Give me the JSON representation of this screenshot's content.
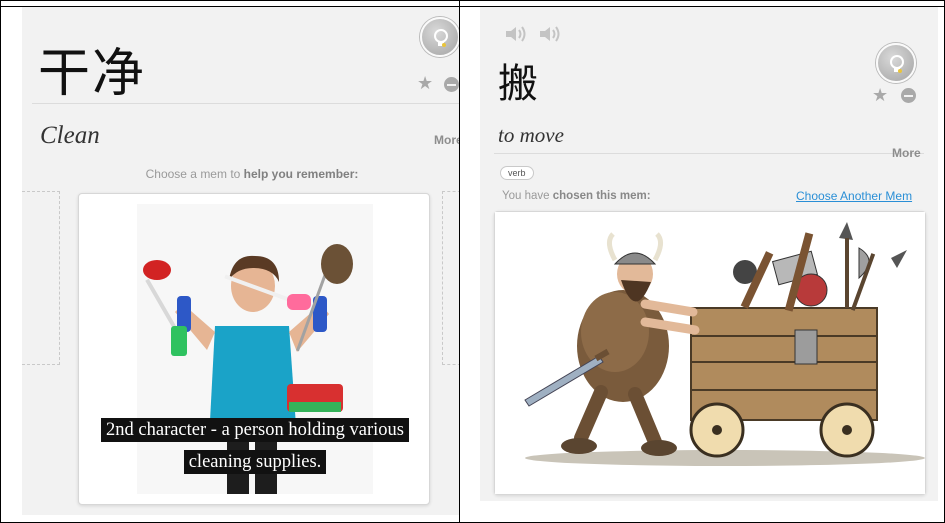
{
  "left_card": {
    "characters": "干净",
    "meaning": "Clean",
    "more_label": "More",
    "choose_prefix": "Choose a mem to",
    "choose_emphasis": "help you remember:",
    "caption": "2nd character - a person holding various cleaning supplies."
  },
  "right_card": {
    "character": "搬",
    "meaning": "to move",
    "more_label": "More",
    "part_of_speech": "verb",
    "chosen_prefix": "You have",
    "chosen_emphasis": "chosen this mem:",
    "choose_another_label": "Choose Another Mem"
  },
  "icons": {
    "lightbulb": "lightbulb-icon",
    "star": "star-icon",
    "remove": "remove-icon",
    "speaker": "speaker-icon"
  },
  "colors": {
    "link": "#2a8fd6",
    "panel_bg": "#f2f2f2",
    "caption_bg": "#111111"
  }
}
